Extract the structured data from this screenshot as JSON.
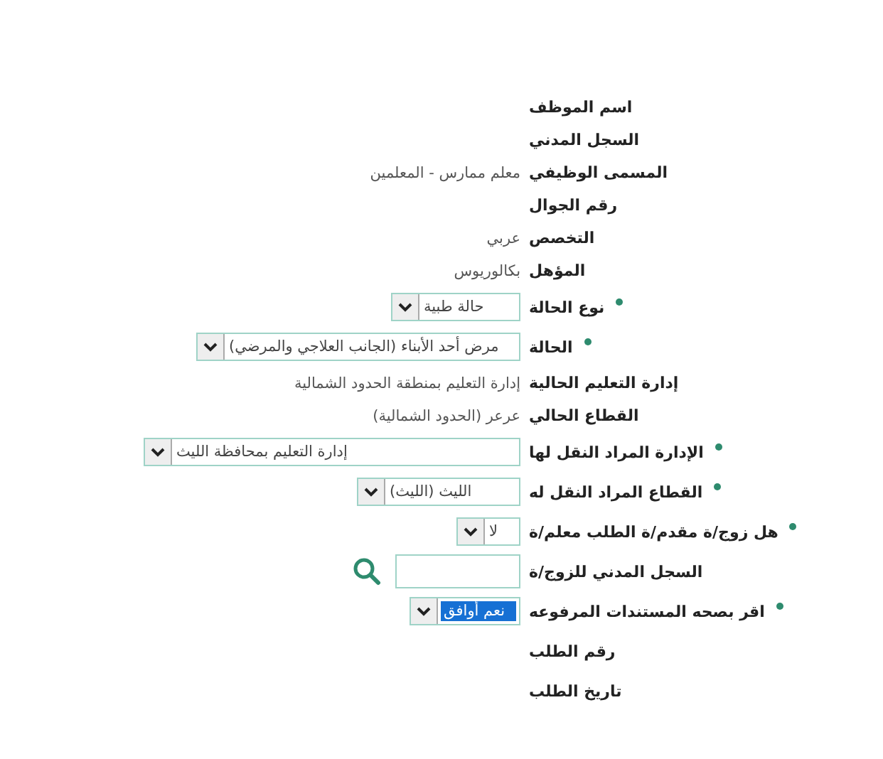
{
  "form": {
    "rows": [
      {
        "label": "اسم الموظف",
        "required": false,
        "kind": "text"
      },
      {
        "label": "السجل المدني",
        "required": false,
        "kind": "text"
      },
      {
        "label": "المسمى الوظيفي",
        "required": false,
        "kind": "text",
        "value": "معلم ممارس - المعلمين"
      },
      {
        "label": "رقم الجوال",
        "required": false,
        "kind": "text"
      },
      {
        "label": "التخصص",
        "required": false,
        "kind": "text",
        "value": "عربي"
      },
      {
        "label": "المؤهل",
        "required": false,
        "kind": "text",
        "value": "بكالوريوس"
      },
      {
        "label": "نوع الحالة",
        "required": true,
        "kind": "select",
        "value": "حالة طبية",
        "focused": false
      },
      {
        "label": "الحالة",
        "required": true,
        "kind": "select",
        "value": "مرض أحد الأبناء (الجانب العلاجي والمرضي)",
        "focused": false
      },
      {
        "label": "إدارة التعليم الحالية",
        "required": false,
        "kind": "text",
        "value": "إدارة التعليم بمنطقة الحدود الشمالية"
      },
      {
        "label": "القطاع الحالي",
        "required": false,
        "kind": "text",
        "value": "عرعر (الحدود الشمالية)"
      },
      {
        "label": "الإدارة المراد النقل لها",
        "required": true,
        "kind": "select",
        "value": "إدارة التعليم بمحافظة الليث",
        "focused": false
      },
      {
        "label": "القطاع المراد النقل له",
        "required": true,
        "kind": "select",
        "value": "الليث (الليث)",
        "focused": false
      },
      {
        "label": "هل زوج/ة مقدم/ة الطلب معلم/ة",
        "required": true,
        "kind": "select",
        "value": "لا",
        "focused": false
      },
      {
        "label": "السجل المدني للزوج/ة",
        "required": false,
        "kind": "search"
      },
      {
        "label": "اقر بصحه المستندات المرفوعه",
        "required": true,
        "kind": "select",
        "value": "نعم أوافق",
        "focused": true
      },
      {
        "label": "رقم الطلب",
        "required": false,
        "kind": "text"
      },
      {
        "label": "تاريخ الطلب",
        "required": false,
        "kind": "text"
      }
    ]
  }
}
